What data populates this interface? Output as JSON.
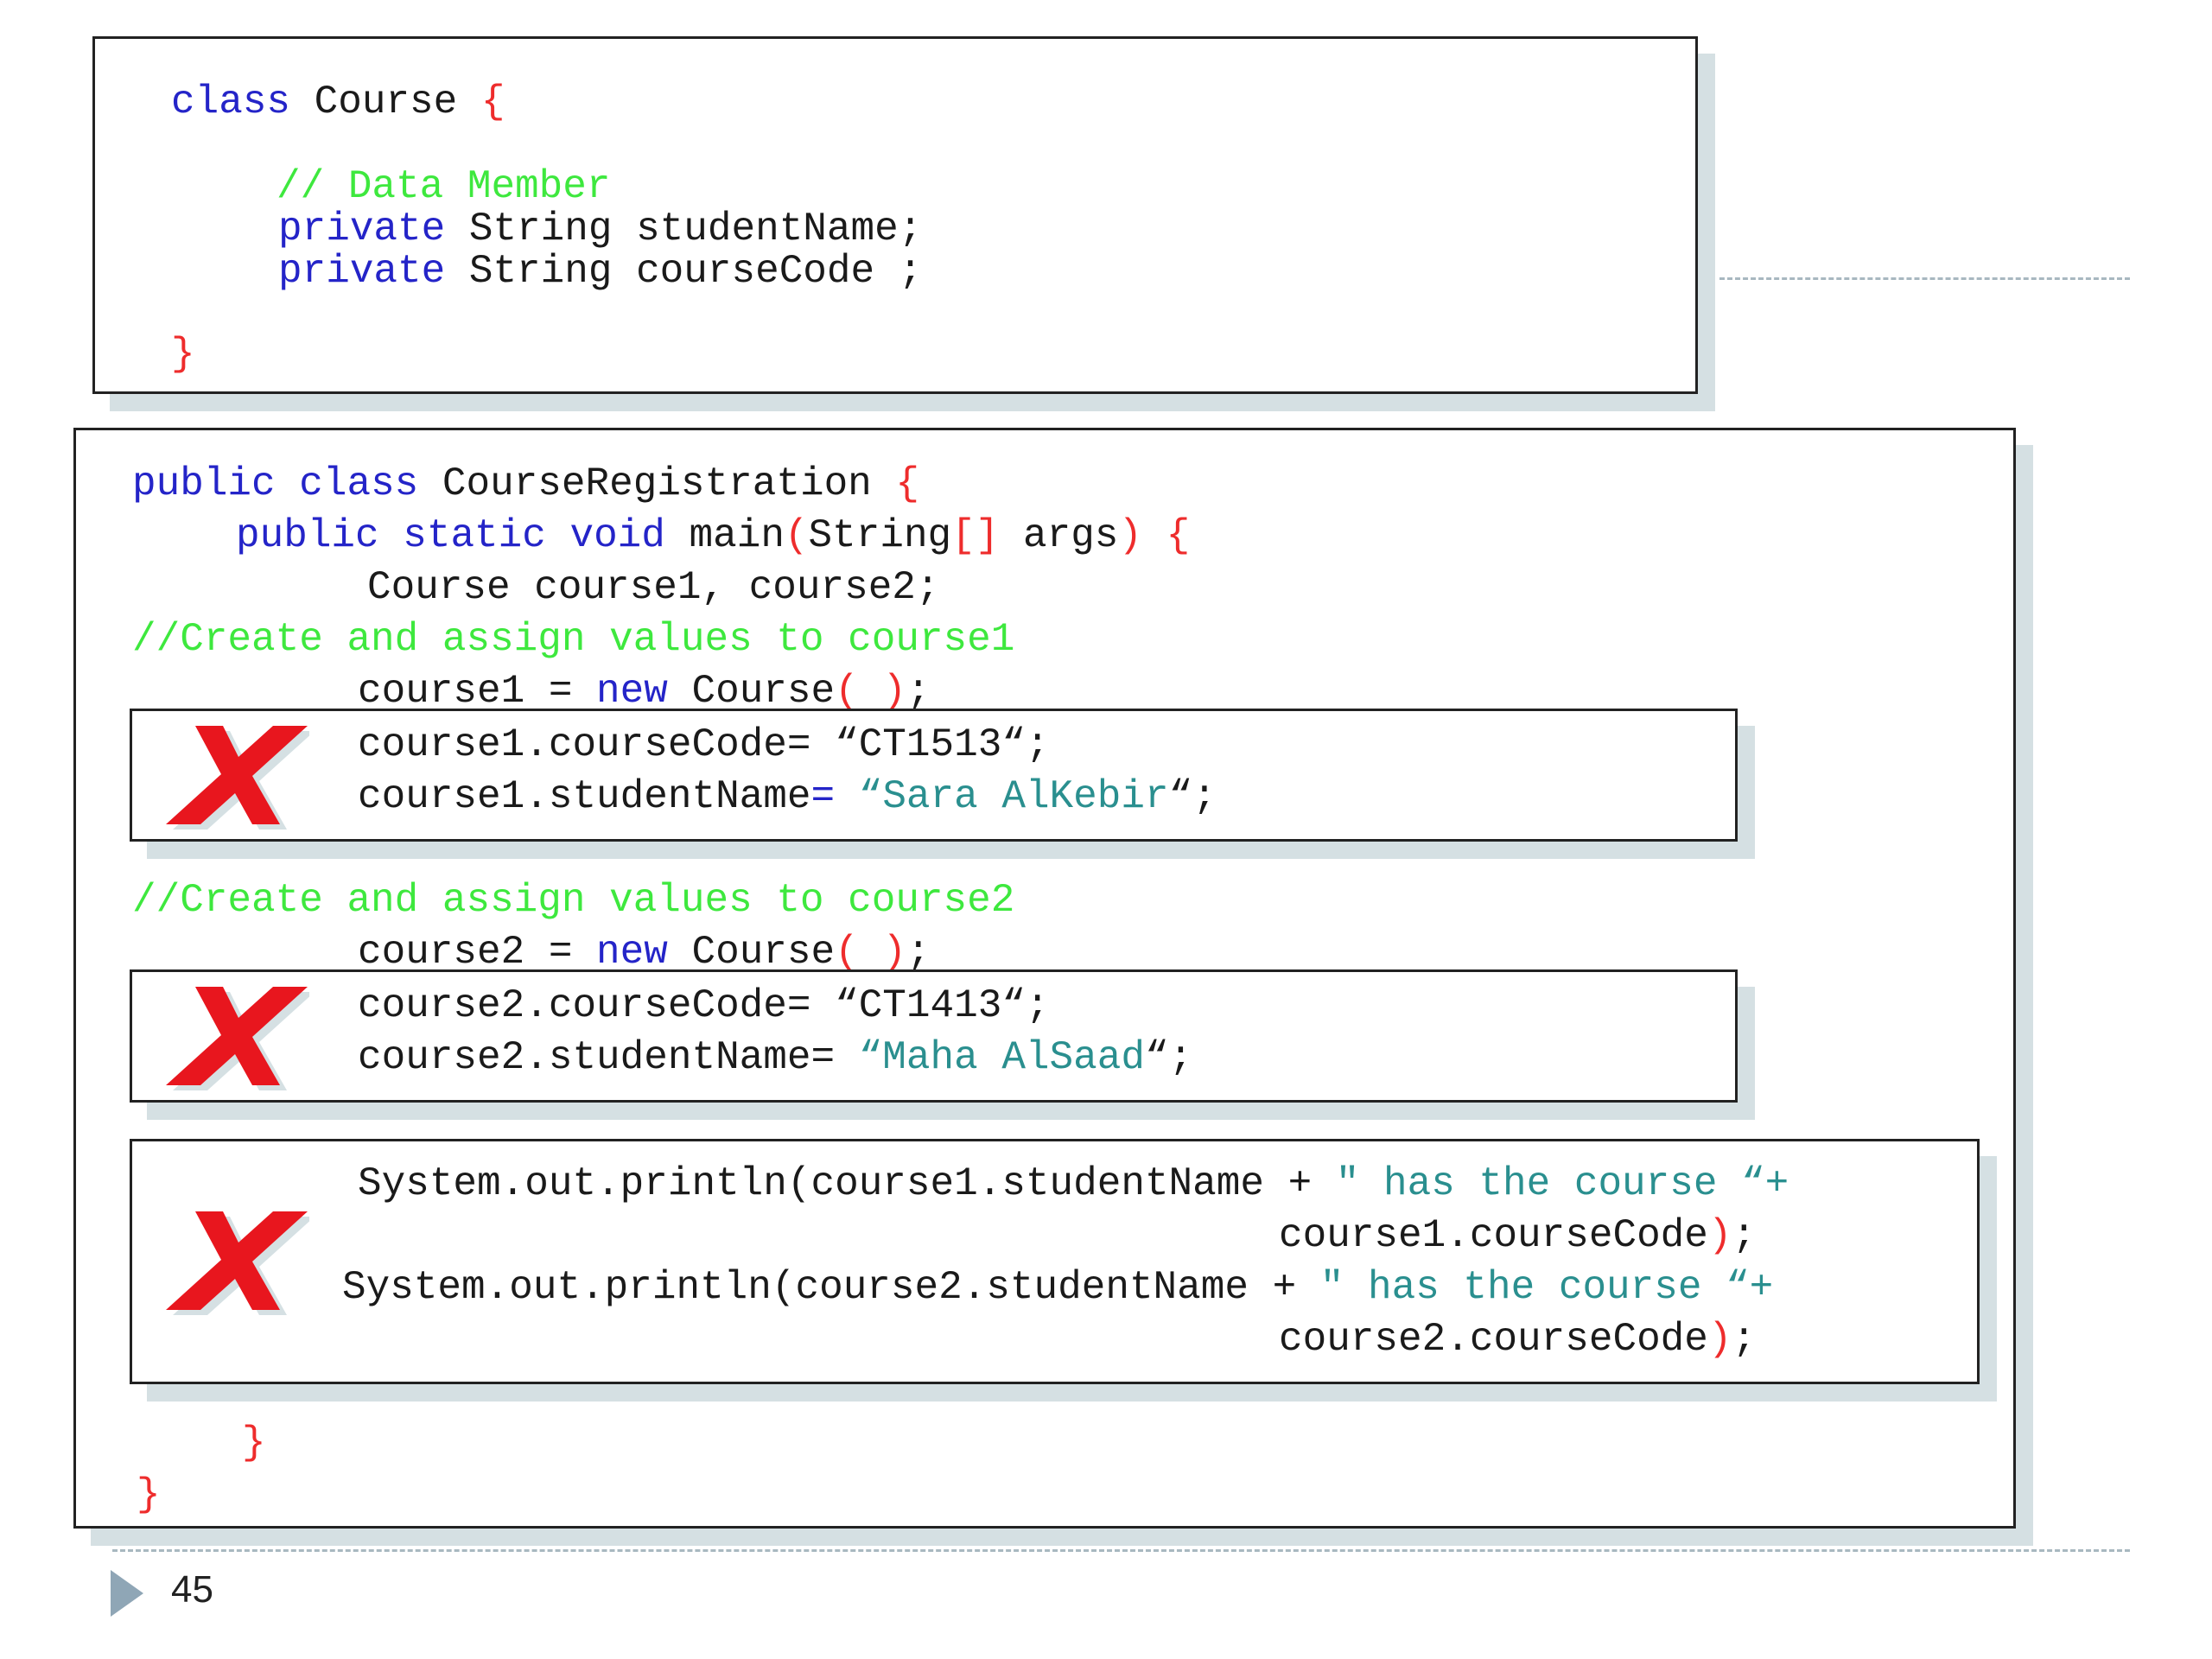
{
  "course_class": {
    "kw_class": "class",
    "name": "Course",
    "open_brace": "{",
    "comment": "// Data Member",
    "field1_kw": "private",
    "field1_decl": "String studentName;",
    "field2_kw": "private",
    "field2_decl": "String courseCode ;",
    "close_brace": "}"
  },
  "registration_class": {
    "kw_public": "public",
    "kw_class": "class",
    "name": "CourseRegistration",
    "open_brace": "{",
    "main_kw": "public static void",
    "main_name": "main",
    "main_paren_open": "(",
    "main_param_type": "String",
    "main_brackets": "[]",
    "main_param_name": " args",
    "main_paren_close": ")",
    "main_open_brace": "{",
    "decl": "Course course1, course2;",
    "comment1": "//Create and assign values to course1",
    "c1_assign": "course1 = ",
    "c1_new": "new",
    "c1_ctor": " Course",
    "c1_parens": "( )",
    "c1_semi": ";",
    "c1_code_lhs": "course1.courseCode= ",
    "c1_code_val": "“CT1513“;",
    "c1_name_lhs": "course1.studentName",
    "c1_name_eq": "=",
    "c1_name_val": " “Sara AlKebir",
    "c1_name_end": "“;",
    "comment2": "//Create and assign values to course2",
    "c2_assign": "course2 = ",
    "c2_new": "new",
    "c2_ctor": " Course",
    "c2_parens": "( )",
    "c2_semi": ";",
    "c2_code_lhs": "course2.courseCode= ",
    "c2_code_val": "“CT1413“;",
    "c2_name_lhs": "course2.studentName= ",
    "c2_name_val": "“Maha AlSaad",
    "c2_name_end": "“;",
    "p1_start": "System.out.println(course1.studentName + ",
    "p1_str": "\" has the course “+",
    "p1_cont": "course1.courseCode",
    "p1_paren": ")",
    "p1_semi": ";",
    "p2_start": "System.out.println(course2.studentName + ",
    "p2_str": "\" has the course “+",
    "p2_cont": "course2.courseCode",
    "p2_paren": ")",
    "p2_semi": ";",
    "main_close": "}",
    "class_close": "}"
  },
  "marks": {
    "x_color": "#e8161e",
    "x_shadow": "#d5e0e3"
  },
  "footer": {
    "page_number": "45"
  }
}
